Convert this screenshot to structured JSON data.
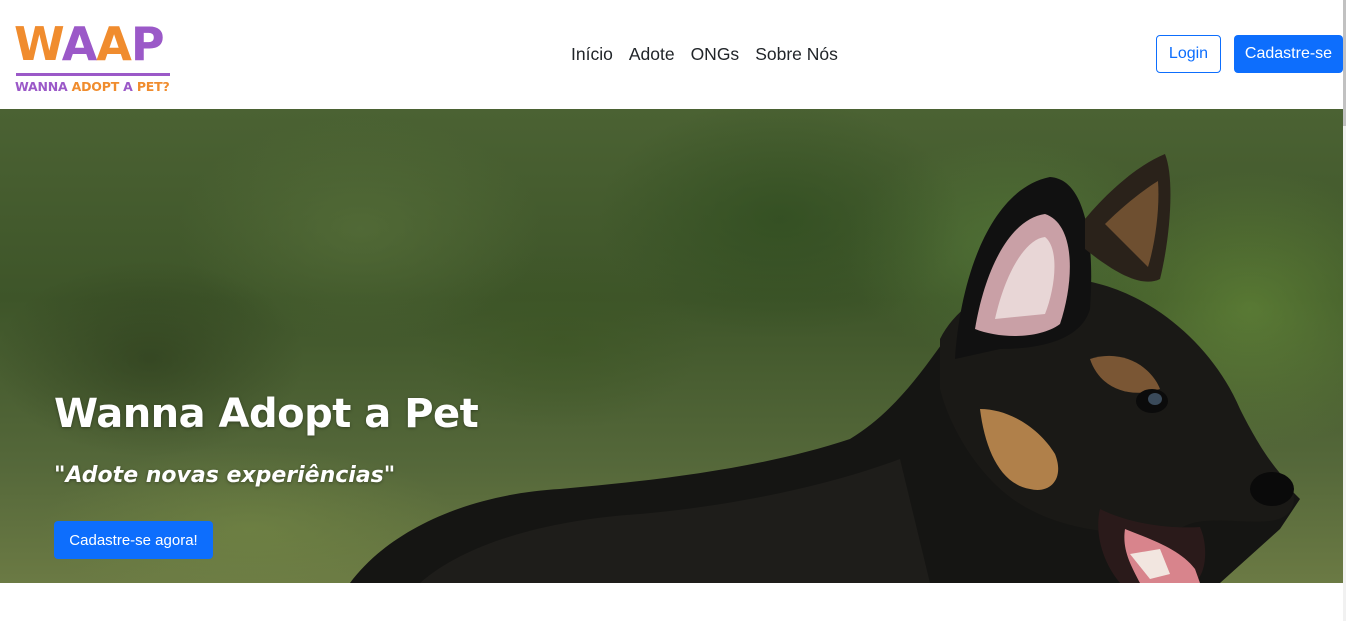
{
  "logo": {
    "main_part1": "W",
    "main_part2": "A",
    "main_part3": "A",
    "main_part4": "P",
    "sub_part1": "WANNA ",
    "sub_part2": "ADOPT",
    "sub_part3": " A ",
    "sub_part4": "PET?"
  },
  "nav": {
    "links": [
      "Início",
      "Adote",
      "ONGs",
      "Sobre Nós"
    ]
  },
  "auth": {
    "login_label": "Login",
    "signup_label": "Cadastre-se"
  },
  "hero": {
    "title": "Wanna Adopt a Pet",
    "subtitle": "\"Adote novas experiências\"",
    "cta_label": "Cadastre-se agora!"
  },
  "colors": {
    "primary": "#0d6efd",
    "logo_orange": "#f08c2e",
    "logo_purple": "#9b59c8"
  }
}
